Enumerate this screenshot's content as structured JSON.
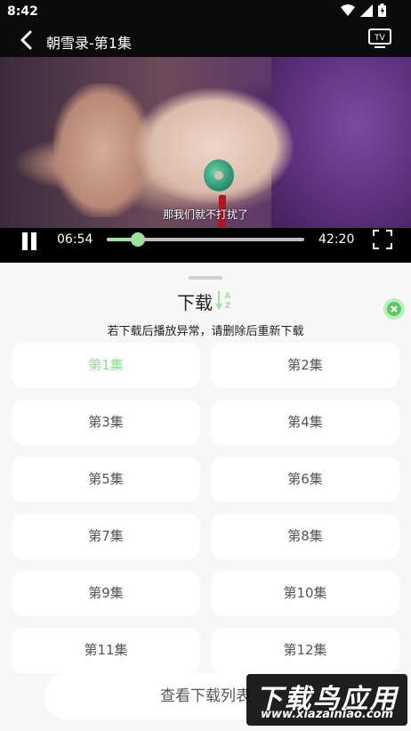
{
  "status_bar": {
    "time": "8:42"
  },
  "header": {
    "title": "朝雪录-第1集",
    "tv_label": "TV"
  },
  "video": {
    "subtitle": "那我们就不打扰了"
  },
  "controls": {
    "current_time": "06:54",
    "total_time": "42:20",
    "progress": 0.156
  },
  "sheet": {
    "title": "下载",
    "hint": "若下载后播放异常，请删除后重新下载",
    "episodes": [
      "第1集",
      "第2集",
      "第3集",
      "第4集",
      "第5集",
      "第6集",
      "第7集",
      "第8集",
      "第9集",
      "第10集",
      "第11集",
      "第12集"
    ],
    "active_index": 0,
    "view_list_label": "查看下载列表"
  },
  "watermark": {
    "main": "下载鸟应用",
    "url": "www.xiazainiao.com"
  },
  "colors": {
    "accent": "#9be39f",
    "sheet_bg": "#f7f7f7",
    "card_bg": "#ffffff"
  },
  "icons": [
    "back-arrow-icon",
    "tv-icon",
    "pause-icon",
    "fullscreen-icon",
    "sort-az-icon",
    "close-icon",
    "wifi-icon",
    "signal-icon",
    "battery-icon"
  ]
}
